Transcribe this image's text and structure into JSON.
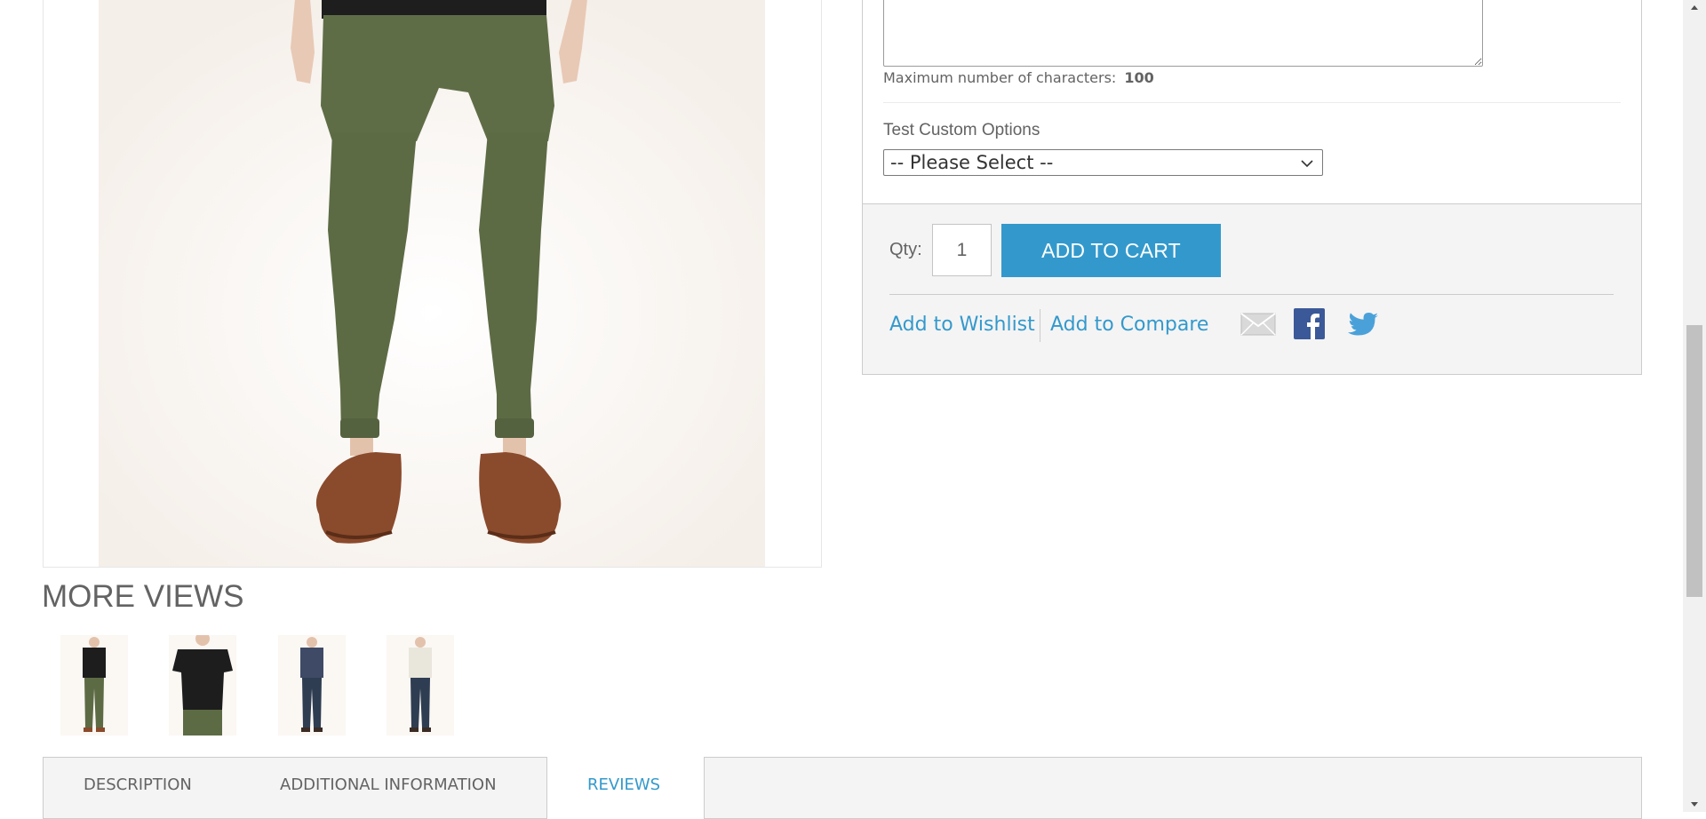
{
  "product_options": {
    "max_chars_label": "Maximum number of characters:",
    "max_chars_value": "100",
    "custom_option_label": "Test Custom Options",
    "custom_option_selected": "-- Please Select --"
  },
  "cart": {
    "qty_label": "Qty:",
    "qty_value": "1",
    "add_to_cart_label": "Add to Cart",
    "wishlist_label": "Add to Wishlist",
    "compare_label": "Add to Compare"
  },
  "share_icons": [
    "email-icon",
    "facebook-icon",
    "twitter-icon"
  ],
  "more_views": {
    "title": "More Views",
    "thumbnails": [
      {
        "shirt": "#1d1d1d",
        "pants": "#5d6b45"
      },
      {
        "shirt": "#1d1d1d",
        "pants": "#5d6b45"
      },
      {
        "shirt": "#3f4a66",
        "pants": "#2f3d52"
      },
      {
        "shirt": "#e9e6dc",
        "pants": "#2f3d52"
      }
    ]
  },
  "tabs": [
    {
      "label": "Description"
    },
    {
      "label": "Additional Information"
    },
    {
      "label": "Reviews",
      "active": true
    }
  ],
  "colors": {
    "accent": "#3399cc",
    "text": "#636363",
    "panel_bg": "#f4f4f4",
    "pants_green": "#5d6b45",
    "shoe_brown": "#8a4a2c"
  }
}
